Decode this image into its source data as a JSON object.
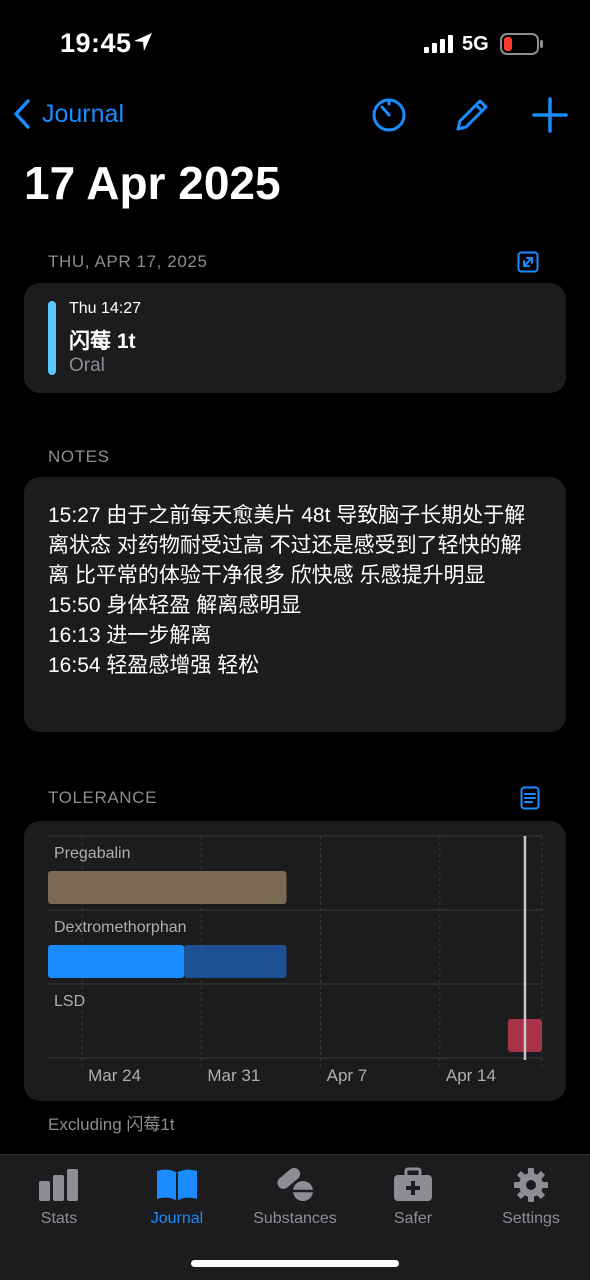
{
  "status_bar": {
    "time": "19:45",
    "network": "5G"
  },
  "nav": {
    "back_label": "Journal"
  },
  "page": {
    "title": "17 Apr 2025"
  },
  "ingestion_section": {
    "header": "THU, APR 17, 2025",
    "item": {
      "time": "Thu 14:27",
      "name": "闪莓 1t",
      "route": "Oral",
      "color": "#5ac8fa"
    }
  },
  "notes_section": {
    "header": "NOTES",
    "text": "15:27 由于之前每天愈美片 48t 导致脑子长期处于解离状态 对药物耐受过高 不过还是感受到了轻快的解离 比平常的体验干净很多 欣快感 乐感提升明显\n15:50 身体轻盈 解离感明显\n16:13 进一步解离\n16:54 轻盈感增强 轻松"
  },
  "tolerance_section": {
    "header": "TOLERANCE",
    "footnote": "Excluding 闪莓1t"
  },
  "chart_data": {
    "type": "timeline",
    "x_ticks": [
      "Mar 24",
      "Mar 31",
      "Apr 7",
      "Apr 14"
    ],
    "x_range": [
      "2025-03-20",
      "2025-04-18"
    ],
    "current_date": "2025-04-17",
    "series": [
      {
        "name": "Pregabalin",
        "color": "#7a6a55",
        "bars": [
          {
            "start": "2025-03-20",
            "end": "2025-04-03",
            "full": true
          }
        ]
      },
      {
        "name": "Dextromethorphan",
        "color": "#1a8cff",
        "bars": [
          {
            "start": "2025-03-20",
            "end": "2025-03-28",
            "full": true
          },
          {
            "start": "2025-03-28",
            "end": "2025-04-03",
            "full": false
          }
        ]
      },
      {
        "name": "LSD",
        "color": "#a83246",
        "bars": [
          {
            "start": "2025-04-16",
            "end": "2025-04-21",
            "full": true
          }
        ]
      }
    ]
  },
  "tab_bar": {
    "tabs": [
      {
        "label": "Stats",
        "icon": "bar-chart-icon"
      },
      {
        "label": "Journal",
        "icon": "book-icon"
      },
      {
        "label": "Substances",
        "icon": "pills-icon"
      },
      {
        "label": "Safer",
        "icon": "medical-kit-icon"
      },
      {
        "label": "Settings",
        "icon": "gear-icon"
      }
    ],
    "active_index": 1
  },
  "colors": {
    "accent": "#1a8cff",
    "card_bg": "#1c1c1e",
    "secondary_text": "#8d8d93",
    "battery_low": "#ff3b30"
  }
}
